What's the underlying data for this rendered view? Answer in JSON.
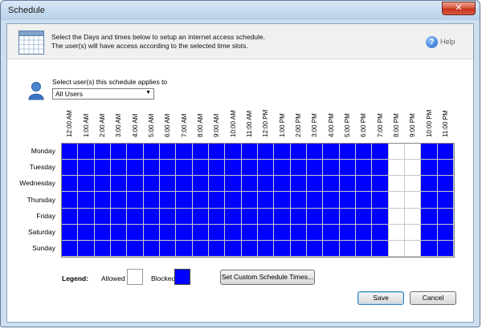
{
  "window": {
    "title": "Schedule",
    "close_glyph": "✕"
  },
  "header": {
    "line1": "Select the Days and times below to setup an internet access schedule.",
    "line2": "The user(s) will have access according to the selected time slots.",
    "help_label": "Help",
    "icon": "calendar-icon"
  },
  "users": {
    "label": "Select user(s) this schedule applies to",
    "selected": "All Users",
    "icon": "user-icon"
  },
  "schedule": {
    "hours": [
      "12:00 AM",
      "1:00 AM",
      "2:00 AM",
      "3:00 AM",
      "4:00 AM",
      "5:00 AM",
      "6:00 AM",
      "7:00 AM",
      "8:00 AM",
      "9:00 AM",
      "10:00 AM",
      "11:00 AM",
      "12:00 PM",
      "1:00 PM",
      "2:00 PM",
      "3:00 PM",
      "4:00 PM",
      "5:00 PM",
      "6:00 PM",
      "7:00 PM",
      "8:00 PM",
      "9:00 PM",
      "10:00 PM",
      "11:00 PM"
    ],
    "days": [
      "Monday",
      "Tuesday",
      "Wednesday",
      "Thursday",
      "Friday",
      "Saturday",
      "Sunday"
    ],
    "allowed_hours": [
      20,
      21
    ],
    "blocked_color": "#0000ff",
    "allowed_color": "#ffffff"
  },
  "legend": {
    "title": "Legend:",
    "allowed": "Allowed",
    "blocked": "Blocked"
  },
  "buttons": {
    "custom": "Set Custom Schedule Times...",
    "save": "Save",
    "cancel": "Cancel"
  }
}
